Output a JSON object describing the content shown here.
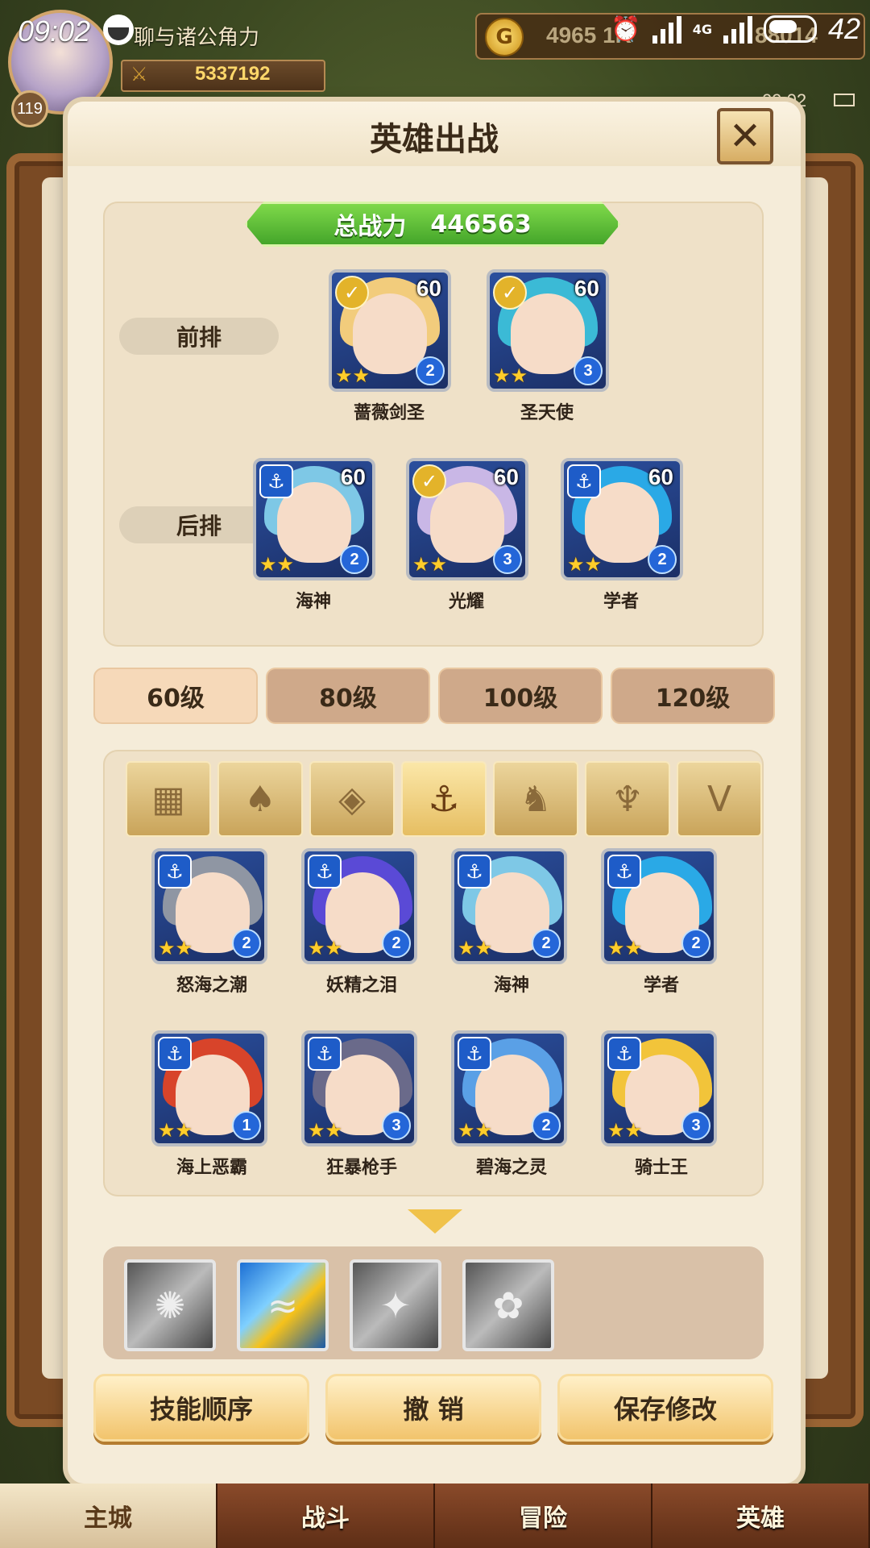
{
  "status_bar": {
    "time": "09:02",
    "battery": "42",
    "network": "4G",
    "sub_time": "09:02"
  },
  "hud": {
    "player_name": "聊与诸公角力",
    "player_level": "119",
    "power": "5337192",
    "gold": "4965",
    "gold_suffix": "1K",
    "diamonds": "880",
    "diamonds_suffix": "14"
  },
  "modal": {
    "title": "英雄出战",
    "total_power_label": "总战力",
    "total_power_value": "446563",
    "front_label": "前排",
    "back_label": "后排"
  },
  "front_row": [
    {
      "name": "蔷薇剑圣",
      "level": "60",
      "role": "chevron",
      "stars": 2,
      "star_level": "2",
      "palette": "#f2cc7c"
    },
    {
      "name": "圣天使",
      "level": "60",
      "role": "chevron",
      "stars": 2,
      "star_level": "3",
      "palette": "#3bbad6"
    }
  ],
  "back_row": [
    {
      "name": "海神",
      "level": "60",
      "role": "anchor",
      "stars": 2,
      "star_level": "2",
      "palette": "#7ec8e6"
    },
    {
      "name": "光耀",
      "level": "60",
      "role": "chevron",
      "stars": 2,
      "star_level": "3",
      "palette": "#c9b7e6"
    },
    {
      "name": "学者",
      "level": "60",
      "role": "anchor",
      "stars": 2,
      "star_level": "2",
      "palette": "#2aa9e6"
    }
  ],
  "level_tabs": [
    "60级",
    "80级",
    "100级",
    "120级"
  ],
  "filters": [
    {
      "icon": "grid-icon",
      "glyph": "▦"
    },
    {
      "icon": "leaf-icon",
      "glyph": "♠"
    },
    {
      "icon": "diamond-icon",
      "glyph": "◈"
    },
    {
      "icon": "anchor-icon",
      "glyph": "⚓"
    },
    {
      "icon": "beast-icon",
      "glyph": "♞"
    },
    {
      "icon": "horn-icon",
      "glyph": "♆"
    },
    {
      "icon": "wing-icon",
      "glyph": "V"
    }
  ],
  "roster": [
    {
      "name": "怒海之潮",
      "stars": 2,
      "star_level": "2",
      "palette": "#8f96a3"
    },
    {
      "name": "妖精之泪",
      "stars": 2,
      "star_level": "2",
      "palette": "#5a4ad6"
    },
    {
      "name": "海神",
      "stars": 2,
      "star_level": "2",
      "palette": "#7ec8e6"
    },
    {
      "name": "学者",
      "stars": 2,
      "star_level": "2",
      "palette": "#2aa9e6"
    },
    {
      "name": "海上恶霸",
      "stars": 2,
      "star_level": "1",
      "palette": "#d8442a"
    },
    {
      "name": "狂暴枪手",
      "stars": 2,
      "star_level": "3",
      "palette": "#6a6a8a"
    },
    {
      "name": "碧海之灵",
      "stars": 2,
      "star_level": "2",
      "palette": "#5aa0e6"
    },
    {
      "name": "骑士王",
      "stars": 2,
      "star_level": "3",
      "palette": "#f2c43a"
    }
  ],
  "skills": [
    {
      "icon": "storm-skill-icon",
      "glyph": "✺",
      "colored": false
    },
    {
      "icon": "wave-skill-icon",
      "glyph": "≈",
      "colored": true
    },
    {
      "icon": "dragon-skill-icon",
      "glyph": "✦",
      "colored": false
    },
    {
      "icon": "spirit-skill-icon",
      "glyph": "✿",
      "colored": false
    }
  ],
  "actions": {
    "skill_order": "技能顺序",
    "undo": "撤 销",
    "save": "保存修改"
  },
  "bottom_nav": [
    "主城",
    "战斗",
    "冒险",
    "英雄"
  ]
}
